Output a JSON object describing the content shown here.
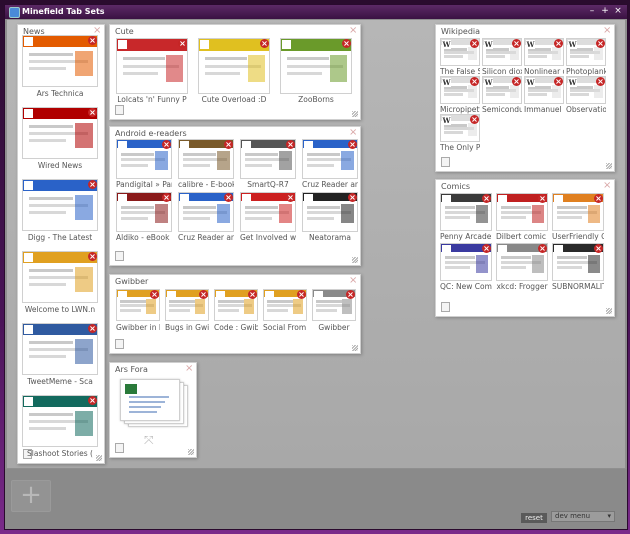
{
  "window": {
    "title": "Minefield Tab Sets",
    "buttons": [
      "–",
      "+",
      "×"
    ]
  },
  "colors": {
    "tab_close": "#c62626",
    "accent_blue": "#2a62c8",
    "workspace": "#ababab"
  },
  "groups": [
    {
      "id": "news",
      "title": "News",
      "tabs": [
        {
          "label": "Ars Technica",
          "favicon": "ars-icon",
          "accent": "#e35b00"
        },
        {
          "label": "Wired News",
          "favicon": "wired-icon",
          "accent": "#b00000"
        },
        {
          "label": "Digg - The Latest",
          "favicon": "digg-icon",
          "accent": "#2a62c8"
        },
        {
          "label": "Welcome to LWN.n",
          "favicon": "lwn-icon",
          "accent": "#e0a020"
        },
        {
          "label": "TweetMeme - Sca",
          "favicon": "tweetmeme-icon",
          "accent": "#2f5aa0"
        },
        {
          "label": "Slashoot Stories (",
          "favicon": "slashdot-icon",
          "accent": "#136a5e"
        }
      ]
    },
    {
      "id": "cute",
      "title": "Cute",
      "tabs": [
        {
          "label": "Lolcats 'n' Funny P",
          "favicon": "lolcats-icon",
          "accent": "#c8282a"
        },
        {
          "label": "Cute Overload :D",
          "favicon": "cuteoverload-icon",
          "accent": "#e0c020"
        },
        {
          "label": "ZooBorns",
          "favicon": "zooborns-icon",
          "accent": "#6a9a2a"
        }
      ]
    },
    {
      "id": "android",
      "title": "Android e-readers",
      "tabs": [
        {
          "label": "Pandigital » Par",
          "favicon": "pandigital-icon",
          "accent": "#2a62c8"
        },
        {
          "label": "calibre - E-book",
          "favicon": "calibre-icon",
          "accent": "#7a5a2a"
        },
        {
          "label": "SmartQ-R7",
          "favicon": "smartq-icon",
          "accent": "#555555"
        },
        {
          "label": "Cruz Reader and",
          "favicon": "cruz-icon",
          "accent": "#2a62c8"
        },
        {
          "label": "Aldiko - eBook I",
          "favicon": "aldiko-icon",
          "accent": "#8a1a1a"
        },
        {
          "label": "Cruz Reader and",
          "favicon": "cruz-icon",
          "accent": "#2a62c8"
        },
        {
          "label": "Get Involved wi",
          "favicon": "android-icon",
          "accent": "#cc2020"
        },
        {
          "label": "Neatorama",
          "favicon": "neatorama-icon",
          "accent": "#222222"
        }
      ]
    },
    {
      "id": "gwibber",
      "title": "Gwibber",
      "tabs": [
        {
          "label": "Gwibber in Lau",
          "favicon": "launchpad-icon",
          "accent": "#e0a020"
        },
        {
          "label": "Bugs in Gwibb",
          "favicon": "launchpad-icon",
          "accent": "#e0a020"
        },
        {
          "label": "Code : Gwibbe",
          "favicon": "launchpad-icon",
          "accent": "#e0a020"
        },
        {
          "label": "Social From th",
          "favicon": "launchpad-icon",
          "accent": "#e0a020"
        },
        {
          "label": "Gwibber",
          "favicon": "gwibber-icon",
          "accent": "#8a8a8a"
        }
      ]
    },
    {
      "id": "arsfora",
      "title": "Ars Fora",
      "tabs": []
    },
    {
      "id": "wikipedia",
      "title": "Wikipedia",
      "tabs": [
        {
          "label": "The False Sub",
          "favicon": "wikipedia-icon",
          "accent": "#dddddd"
        },
        {
          "label": "Silicon dioxide",
          "favicon": "wikipedia-icon",
          "accent": "#dddddd"
        },
        {
          "label": "Nonlinear opt",
          "favicon": "wikipedia-icon",
          "accent": "#dddddd"
        },
        {
          "label": "Photoplankto",
          "favicon": "wikipedia-icon",
          "accent": "#dddddd"
        },
        {
          "label": "Micropipetter",
          "favicon": "wikipedia-icon",
          "accent": "#dddddd"
        },
        {
          "label": "Semiconducto",
          "favicon": "wikipedia-icon",
          "accent": "#dddddd"
        },
        {
          "label": "Immanuel Kar",
          "favicon": "wikipedia-icon",
          "accent": "#dddddd"
        },
        {
          "label": "Observations",
          "favicon": "wikipedia-icon",
          "accent": "#dddddd"
        },
        {
          "label": "The Only Poss",
          "favicon": "wikipedia-icon",
          "accent": "#dddddd"
        }
      ]
    },
    {
      "id": "comics",
      "title": "Comics",
      "tabs": [
        {
          "label": "Penny Arcade!",
          "favicon": "pennyarcade-icon",
          "accent": "#3a3a3a"
        },
        {
          "label": "Dilbert comic s",
          "favicon": "dilbert-icon",
          "accent": "#c02020"
        },
        {
          "label": "UserFriendly Or",
          "favicon": "userfriendly-icon",
          "accent": "#e08020"
        },
        {
          "label": "QC: New Comic",
          "favicon": "qc-icon",
          "accent": "#3a3aa0"
        },
        {
          "label": "xkcd: Frogger",
          "favicon": "xkcd-icon",
          "accent": "#888888"
        },
        {
          "label": "SUBNORMALIT",
          "favicon": "subnormality-icon",
          "accent": "#2a2a2a"
        }
      ]
    }
  ],
  "footer": {
    "add_label": "+",
    "reset_label": "reset",
    "dev_menu_label": "dev menu"
  }
}
